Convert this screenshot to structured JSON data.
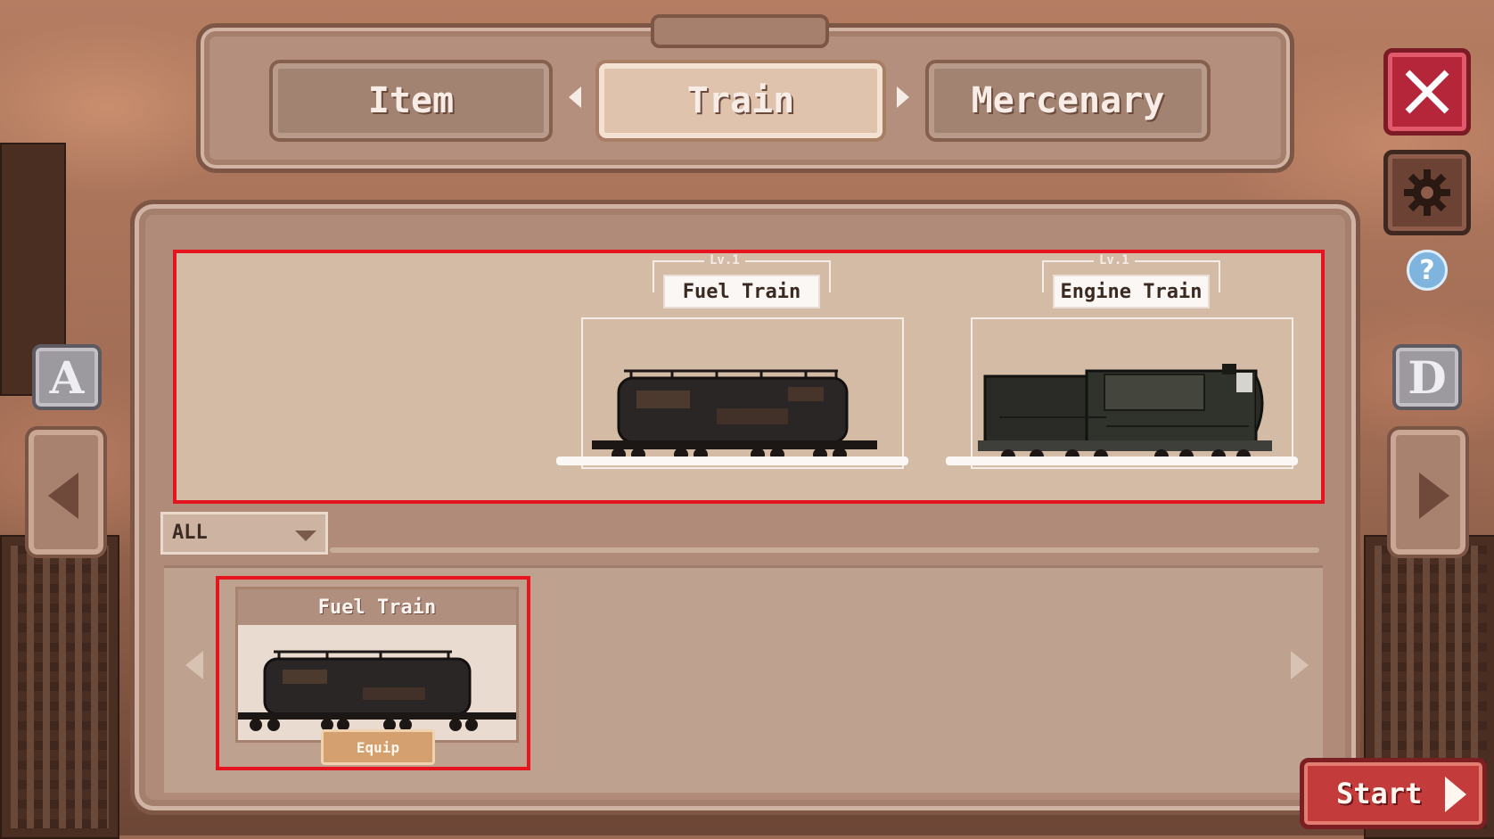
{
  "tabs": {
    "item": "Item",
    "train": "Train",
    "mercenary": "Mercenary",
    "active": "Train"
  },
  "preview": {
    "cars": [
      {
        "level": "Lv.1",
        "name": "Fuel Train"
      },
      {
        "level": "Lv.1",
        "name": "Engine Train"
      }
    ]
  },
  "filter": {
    "selected": "ALL"
  },
  "inventory": {
    "items": [
      {
        "name": "Fuel Train",
        "button": "Equip"
      }
    ]
  },
  "side": {
    "left_key": "A",
    "right_key": "D",
    "help": "?"
  },
  "start": {
    "label": "Start"
  },
  "colors": {
    "highlight": "#e5141e",
    "close": "#b6263a",
    "start": "#c33b3a",
    "panel": "#b18b79"
  }
}
